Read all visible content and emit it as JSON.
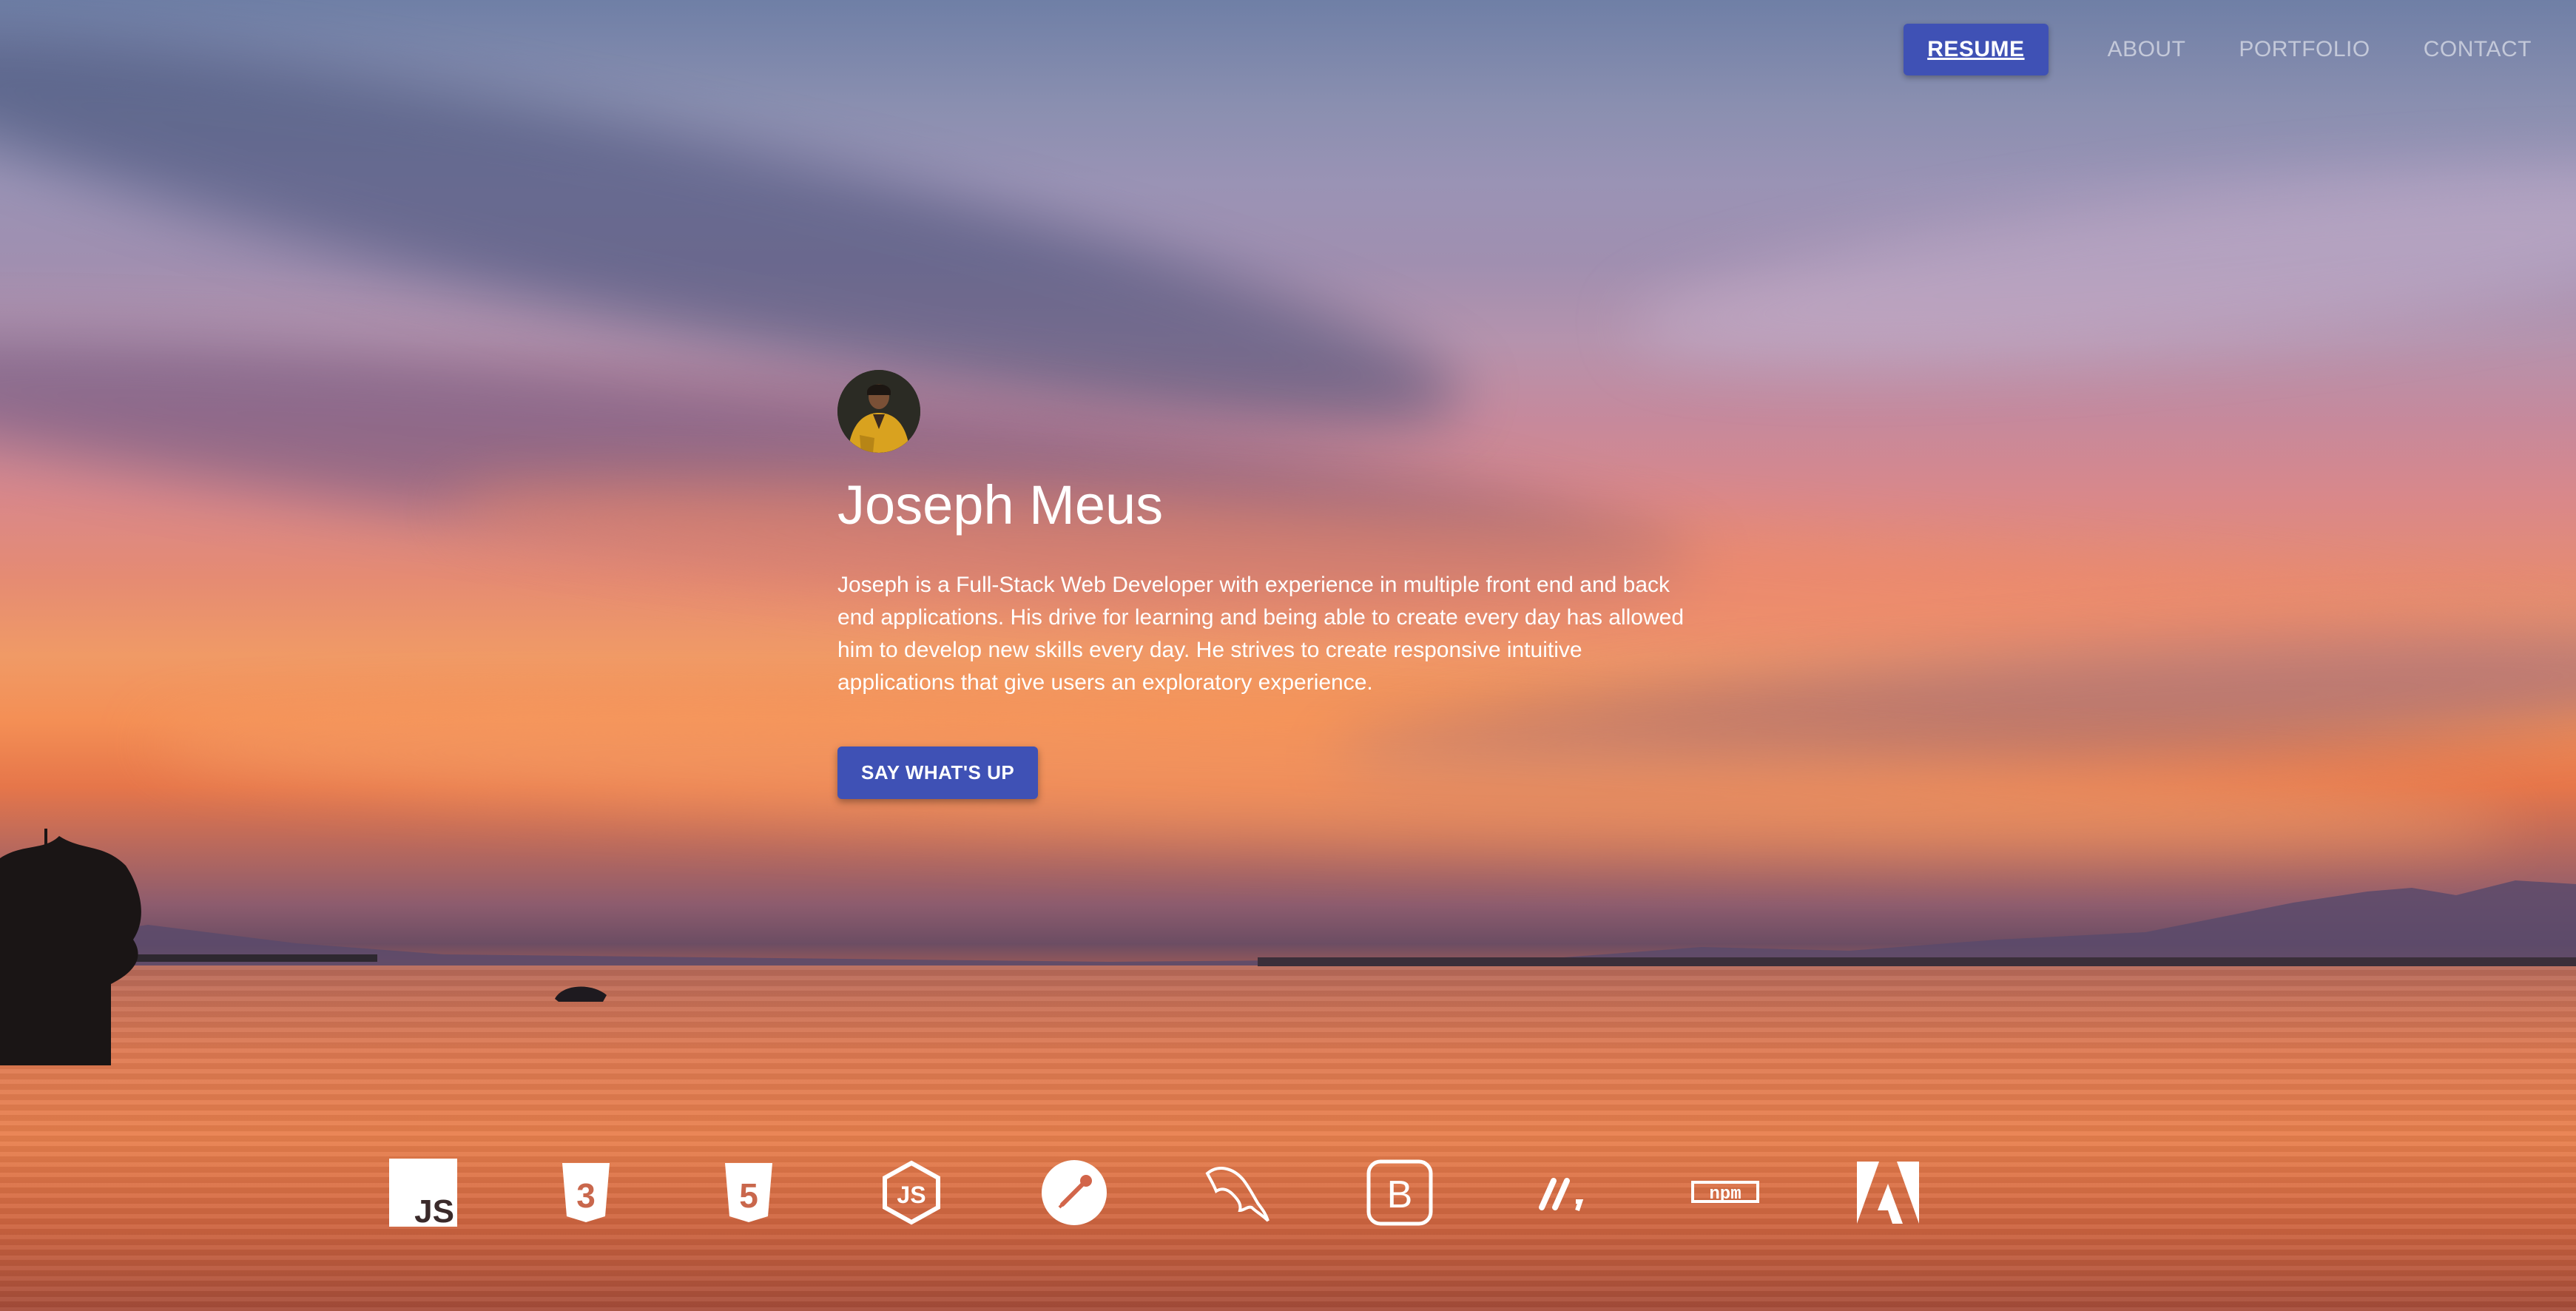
{
  "nav": {
    "items": [
      {
        "label": "RESUME",
        "active": true
      },
      {
        "label": "ABOUT",
        "active": false
      },
      {
        "label": "PORTFOLIO",
        "active": false
      },
      {
        "label": "CONTACT",
        "active": false
      }
    ]
  },
  "hero": {
    "name": "Joseph Meus",
    "bio": "Joseph is a Full-Stack Web Developer with experience in multiple front end and back end applications. His drive for learning and being able to create every day has allowed him to develop new skills every day. He strives to create responsive intuitive applications that give users an exploratory experience.",
    "cta_label": "SAY WHAT'S UP"
  },
  "tech_icons": [
    {
      "name": "javascript-icon",
      "glyph": "JS"
    },
    {
      "name": "css3-icon",
      "glyph": "3"
    },
    {
      "name": "html5-icon",
      "glyph": "5"
    },
    {
      "name": "nodejs-icon",
      "glyph": "JS"
    },
    {
      "name": "postman-icon",
      "glyph": ""
    },
    {
      "name": "mysql-icon",
      "glyph": ""
    },
    {
      "name": "bootstrap-icon",
      "glyph": "B"
    },
    {
      "name": "express-icon",
      "glyph": "//,"
    },
    {
      "name": "npm-icon",
      "glyph": "npm"
    },
    {
      "name": "adobe-icon",
      "glyph": ""
    }
  ],
  "colors": {
    "accent": "#3f51b5",
    "text": "#ffffff"
  }
}
